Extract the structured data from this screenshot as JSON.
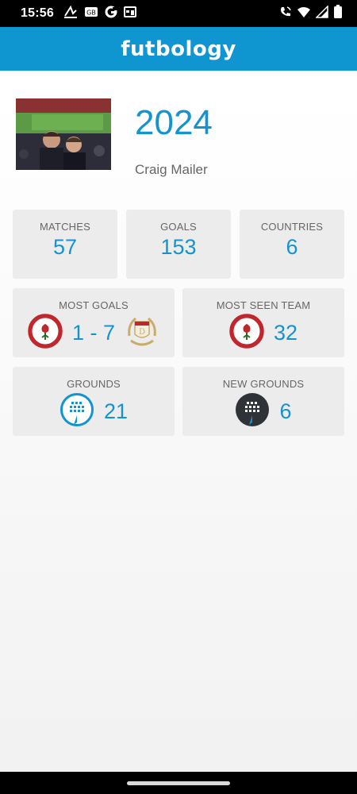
{
  "status": {
    "time": "15:56"
  },
  "app": {
    "brand": "futbology"
  },
  "profile": {
    "year": "2024",
    "name": "Craig Mailer"
  },
  "stats": {
    "matches": {
      "label": "MATCHES",
      "value": "57"
    },
    "goals": {
      "label": "GOALS",
      "value": "153"
    },
    "countries": {
      "label": "COUNTRIES",
      "value": "6"
    },
    "most_goals": {
      "label": "MOST GOALS",
      "score": "1 - 7"
    },
    "most_seen_team": {
      "label": "MOST SEEN TEAM",
      "value": "32"
    },
    "grounds": {
      "label": "GROUNDS",
      "value": "21"
    },
    "new_grounds": {
      "label": "NEW GROUNDS",
      "value": "6"
    }
  },
  "colors": {
    "accent": "#1393cf",
    "appbar": "#0f96d0",
    "card": "#ececec"
  },
  "icons": [
    "gesture-icon",
    "gb-icon",
    "google-icon",
    "calendar-icon",
    "wifi-call-icon",
    "wifi-icon",
    "signal-icon",
    "battery-icon",
    "club-crest-red-icon",
    "club-crest-gold-icon",
    "stadium-icon",
    "stadium-dark-icon"
  ]
}
